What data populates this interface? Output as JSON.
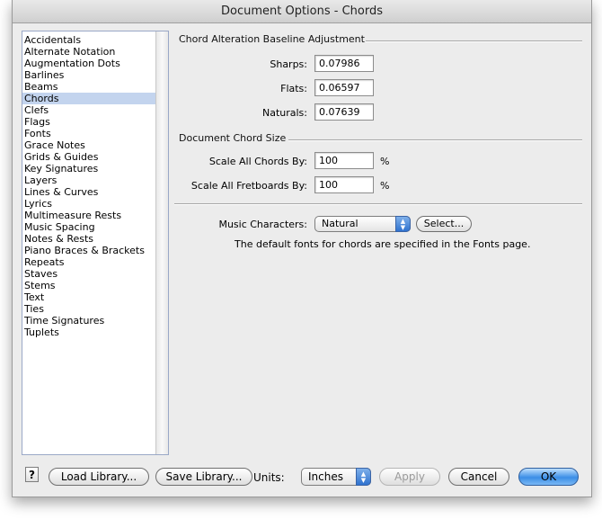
{
  "window": {
    "title": "Document Options - Chords"
  },
  "sidebar": {
    "selected_index": 5,
    "items": [
      "Accidentals",
      "Alternate Notation",
      "Augmentation Dots",
      "Barlines",
      "Beams",
      "Chords",
      "Clefs",
      "Flags",
      "Fonts",
      "Grace Notes",
      "Grids & Guides",
      "Key Signatures",
      "Layers",
      "Lines & Curves",
      "Lyrics",
      "Multimeasure Rests",
      "Music Spacing",
      "Notes & Rests",
      "Piano Braces & Brackets",
      "Repeats",
      "Staves",
      "Stems",
      "Text",
      "Ties",
      "Time Signatures",
      "Tuplets"
    ]
  },
  "baseline": {
    "title": "Chord Alteration Baseline Adjustment",
    "sharps_label": "Sharps:",
    "sharps_value": "0.07986",
    "flats_label": "Flats:",
    "flats_value": "0.06597",
    "naturals_label": "Naturals:",
    "naturals_value": "0.07639"
  },
  "size": {
    "title": "Document Chord Size",
    "chords_label": "Scale All Chords By:",
    "chords_value": "100",
    "chords_unit": "%",
    "fretboards_label": "Scale All Fretboards By:",
    "fretboards_value": "100",
    "fretboards_unit": "%"
  },
  "music": {
    "label": "Music Characters:",
    "value": "Natural",
    "select_button": "Select...",
    "info": "The default fonts for chords are specified in the Fonts page."
  },
  "footer": {
    "help": "?",
    "load_library": "Load Library...",
    "save_library": "Save Library...",
    "units_label": "Units:",
    "units_value": "Inches",
    "apply": "Apply",
    "cancel": "Cancel",
    "ok": "OK"
  }
}
